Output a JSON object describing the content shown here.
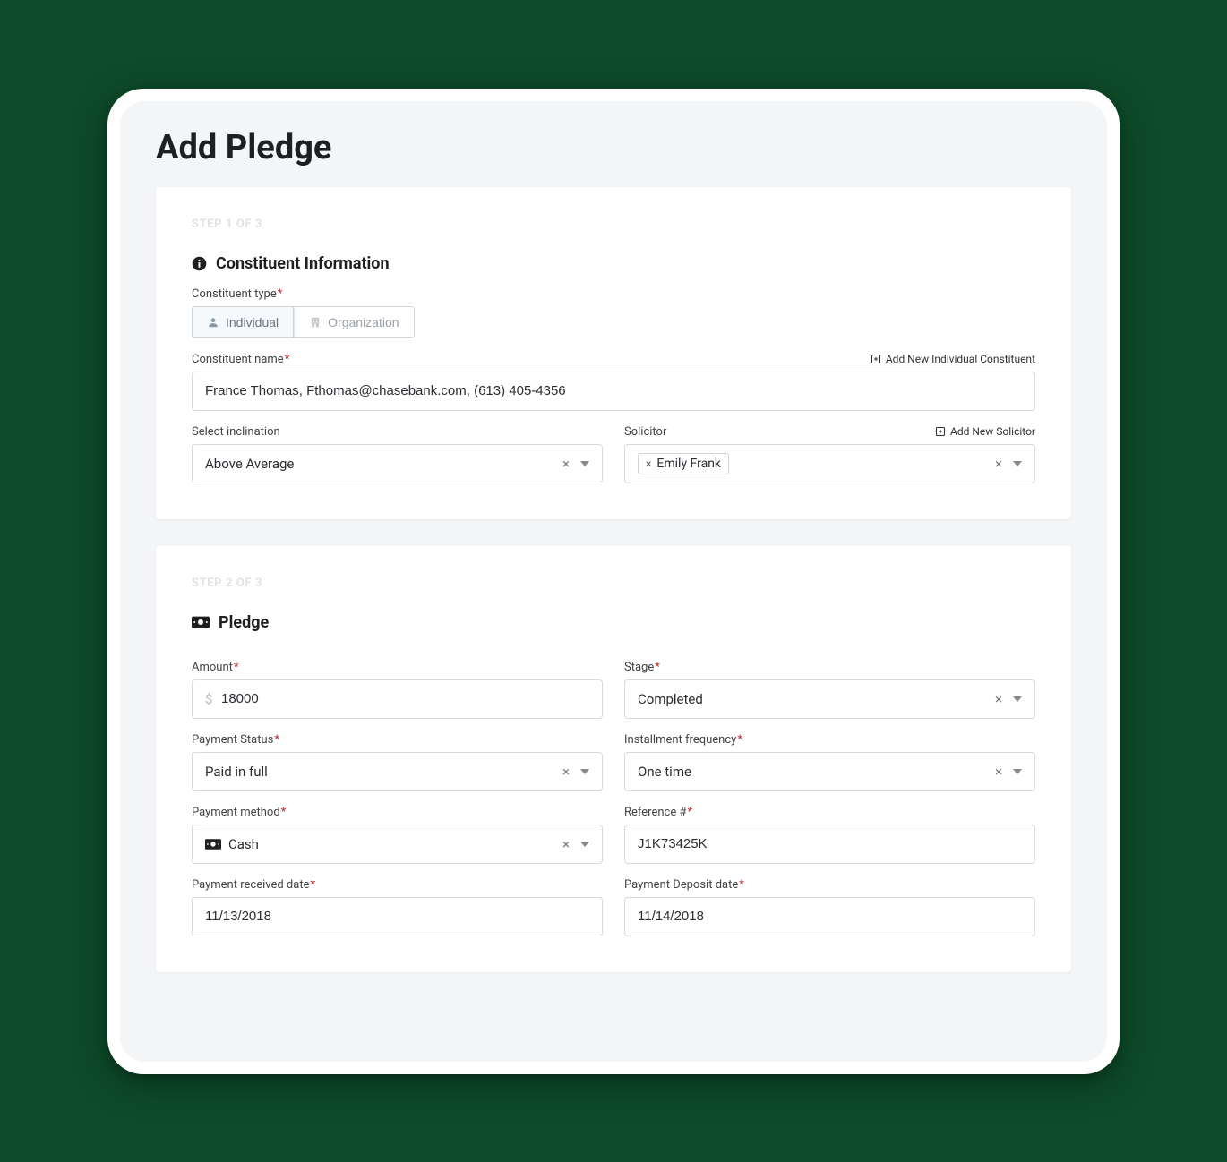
{
  "page": {
    "title": "Add Pledge"
  },
  "step1": {
    "step_label": "STEP 1 OF 3",
    "section_title": "Constituent Information",
    "constituent_type_label": "Constituent type",
    "individual_label": "Individual",
    "organization_label": "Organization",
    "constituent_name_label": "Constituent name",
    "add_new_individual_label": "Add New Individual Constituent",
    "constituent_name_value": "France Thomas, Fthomas@chasebank.com, (613) 405-4356",
    "inclination_label": "Select inclination",
    "inclination_value": "Above Average",
    "solicitor_label": "Solicitor",
    "add_new_solicitor_label": "Add New Solicitor",
    "solicitor_token": "Emily Frank"
  },
  "step2": {
    "step_label": "STEP 2 OF 3",
    "section_title": "Pledge",
    "amount_label": "Amount",
    "amount_value": "18000",
    "amount_prefix": "$",
    "stage_label": "Stage",
    "stage_value": "Completed",
    "payment_status_label": "Payment Status",
    "payment_status_value": "Paid in full",
    "installment_label": "Installment frequency",
    "installment_value": "One time",
    "payment_method_label": "Payment method",
    "payment_method_value": "Cash",
    "reference_label": "Reference #",
    "reference_value": "J1K73425K",
    "received_date_label": "Payment received date",
    "received_date_value": "11/13/2018",
    "deposit_date_label": "Payment Deposit date",
    "deposit_date_value": "11/14/2018"
  }
}
